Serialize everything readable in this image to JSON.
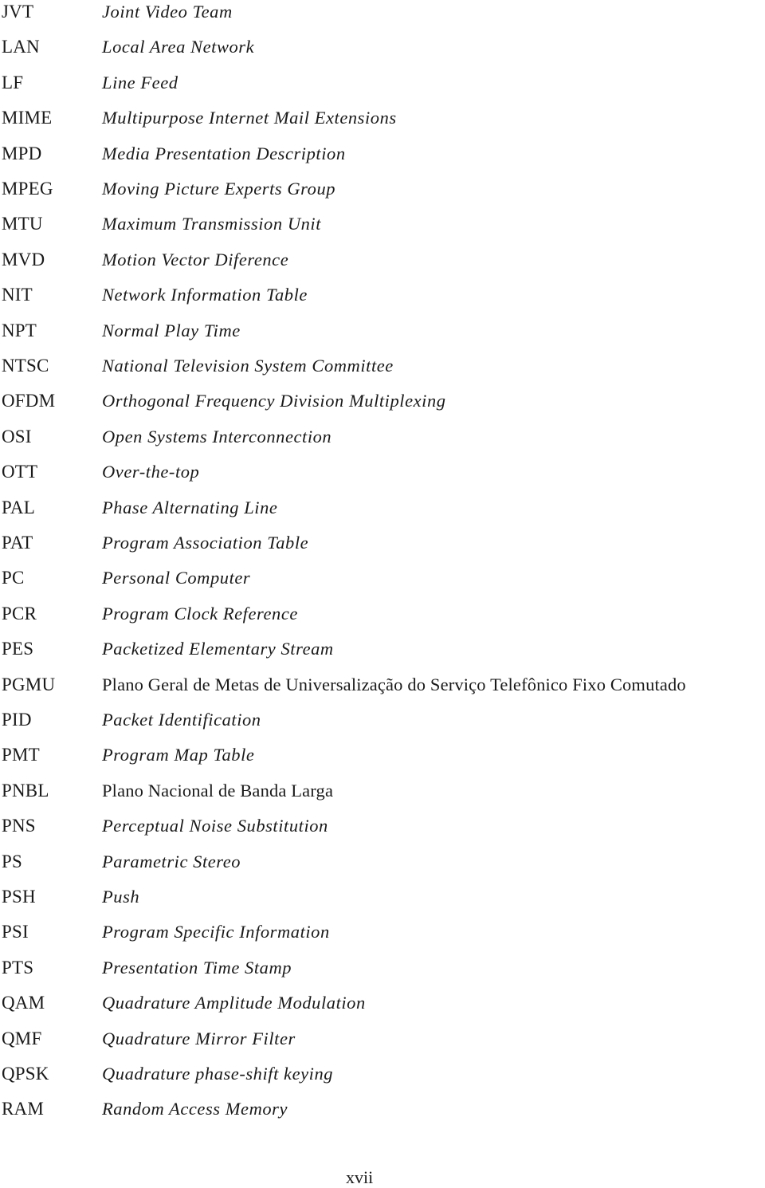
{
  "document": {
    "type": "List of Abbreviations (continued)",
    "page_number": "xvii",
    "entries": [
      {
        "abbr": "JVT",
        "definition": "Joint Video Team",
        "italic": true
      },
      {
        "abbr": "LAN",
        "definition": "Local Area Network",
        "italic": true
      },
      {
        "abbr": "LF",
        "definition": "Line Feed",
        "italic": true
      },
      {
        "abbr": "MIME",
        "definition": "Multipurpose Internet Mail Extensions",
        "italic": true
      },
      {
        "abbr": "MPD",
        "definition": "Media Presentation Description",
        "italic": true
      },
      {
        "abbr": "MPEG",
        "definition": "Moving Picture Experts Group",
        "italic": true
      },
      {
        "abbr": "MTU",
        "definition": "Maximum Transmission Unit",
        "italic": true
      },
      {
        "abbr": "MVD",
        "definition": "Motion Vector Diference",
        "italic": true
      },
      {
        "abbr": "NIT",
        "definition": "Network Information Table",
        "italic": true
      },
      {
        "abbr": "NPT",
        "definition": "Normal Play Time",
        "italic": true
      },
      {
        "abbr": "NTSC",
        "definition": "National Television System Committee",
        "italic": true
      },
      {
        "abbr": "OFDM",
        "definition": "Orthogonal Frequency Division Multiplexing",
        "italic": true
      },
      {
        "abbr": "OSI",
        "definition": "Open Systems Interconnection",
        "italic": true
      },
      {
        "abbr": "OTT",
        "definition": "Over-the-top",
        "italic": true
      },
      {
        "abbr": "PAL",
        "definition": "Phase Alternating Line",
        "italic": true
      },
      {
        "abbr": "PAT",
        "definition": "Program Association Table",
        "italic": true
      },
      {
        "abbr": "PC",
        "definition": "Personal Computer",
        "italic": true
      },
      {
        "abbr": "PCR",
        "definition": "Program Clock Reference",
        "italic": true
      },
      {
        "abbr": "PES",
        "definition": "Packetized Elementary Stream",
        "italic": true
      },
      {
        "abbr": "PGMU",
        "definition": "Plano Geral de Metas de Universalização do Serviço Telefônico Fixo Comutado",
        "italic": false
      },
      {
        "abbr": "PID",
        "definition": "Packet Identification",
        "italic": true
      },
      {
        "abbr": "PMT",
        "definition": "Program Map Table",
        "italic": true
      },
      {
        "abbr": "PNBL",
        "definition": "Plano Nacional de Banda Larga",
        "italic": false
      },
      {
        "abbr": "PNS",
        "definition": "Perceptual Noise Substitution",
        "italic": true
      },
      {
        "abbr": "PS",
        "definition": "Parametric Stereo",
        "italic": true
      },
      {
        "abbr": "PSH",
        "definition": "Push",
        "italic": true
      },
      {
        "abbr": "PSI",
        "definition": "Program Specific Information",
        "italic": true
      },
      {
        "abbr": "PTS",
        "definition": "Presentation Time Stamp",
        "italic": true
      },
      {
        "abbr": "QAM",
        "definition": "Quadrature Amplitude Modulation",
        "italic": true
      },
      {
        "abbr": "QMF",
        "definition": "Quadrature Mirror Filter",
        "italic": true
      },
      {
        "abbr": "QPSK",
        "definition": "Quadrature phase-shift keying",
        "italic": true
      },
      {
        "abbr": "RAM",
        "definition": "Random Access Memory",
        "italic": true
      }
    ]
  }
}
